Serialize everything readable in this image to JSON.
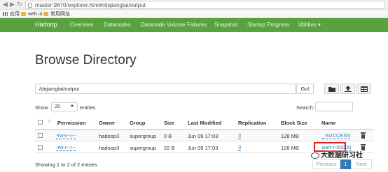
{
  "browser": {
    "url": "master:9870/explorer.html#/dajiangtai/output",
    "bookmarks": [
      "应用",
      "web ui",
      "常用网址"
    ]
  },
  "navbar": {
    "brand": "Hadoop",
    "items": [
      "Overview",
      "Datanodes",
      "Datanode Volume Failures",
      "Snapshot",
      "Startup Progress",
      "Utilities ▾"
    ]
  },
  "page_title": "Browse Directory",
  "path": {
    "value": "/dajiangtai/output",
    "go_label": "Go!"
  },
  "controls": {
    "show_label": "Show",
    "show_value": "25",
    "entries_label": "entries",
    "search_label": "Search:"
  },
  "table": {
    "headers": [
      "Permission",
      "Owner",
      "Group",
      "Size",
      "Last Modified",
      "Replication",
      "Block Size",
      "Name"
    ],
    "rows": [
      [
        "-rw-r--r--",
        "hadoop3",
        "supergroup",
        "0 B",
        "Jun 09 17:03",
        "3",
        "128 MB",
        "_SUCCESS"
      ],
      [
        "-rw-r--r--",
        "hadoop3",
        "supergroup",
        "22 B",
        "Jun 09 17:03",
        "3",
        "128 MB",
        "part-r-00000"
      ]
    ]
  },
  "footer": {
    "info": "Showing 1 to 2 of 2 entries",
    "previous": "Previous",
    "page": "1",
    "next": "Next"
  },
  "watermark": "大数据研习社",
  "colors": {
    "navbar": "#59a33e",
    "link": "#337ab7",
    "highlight": "#e02020"
  }
}
